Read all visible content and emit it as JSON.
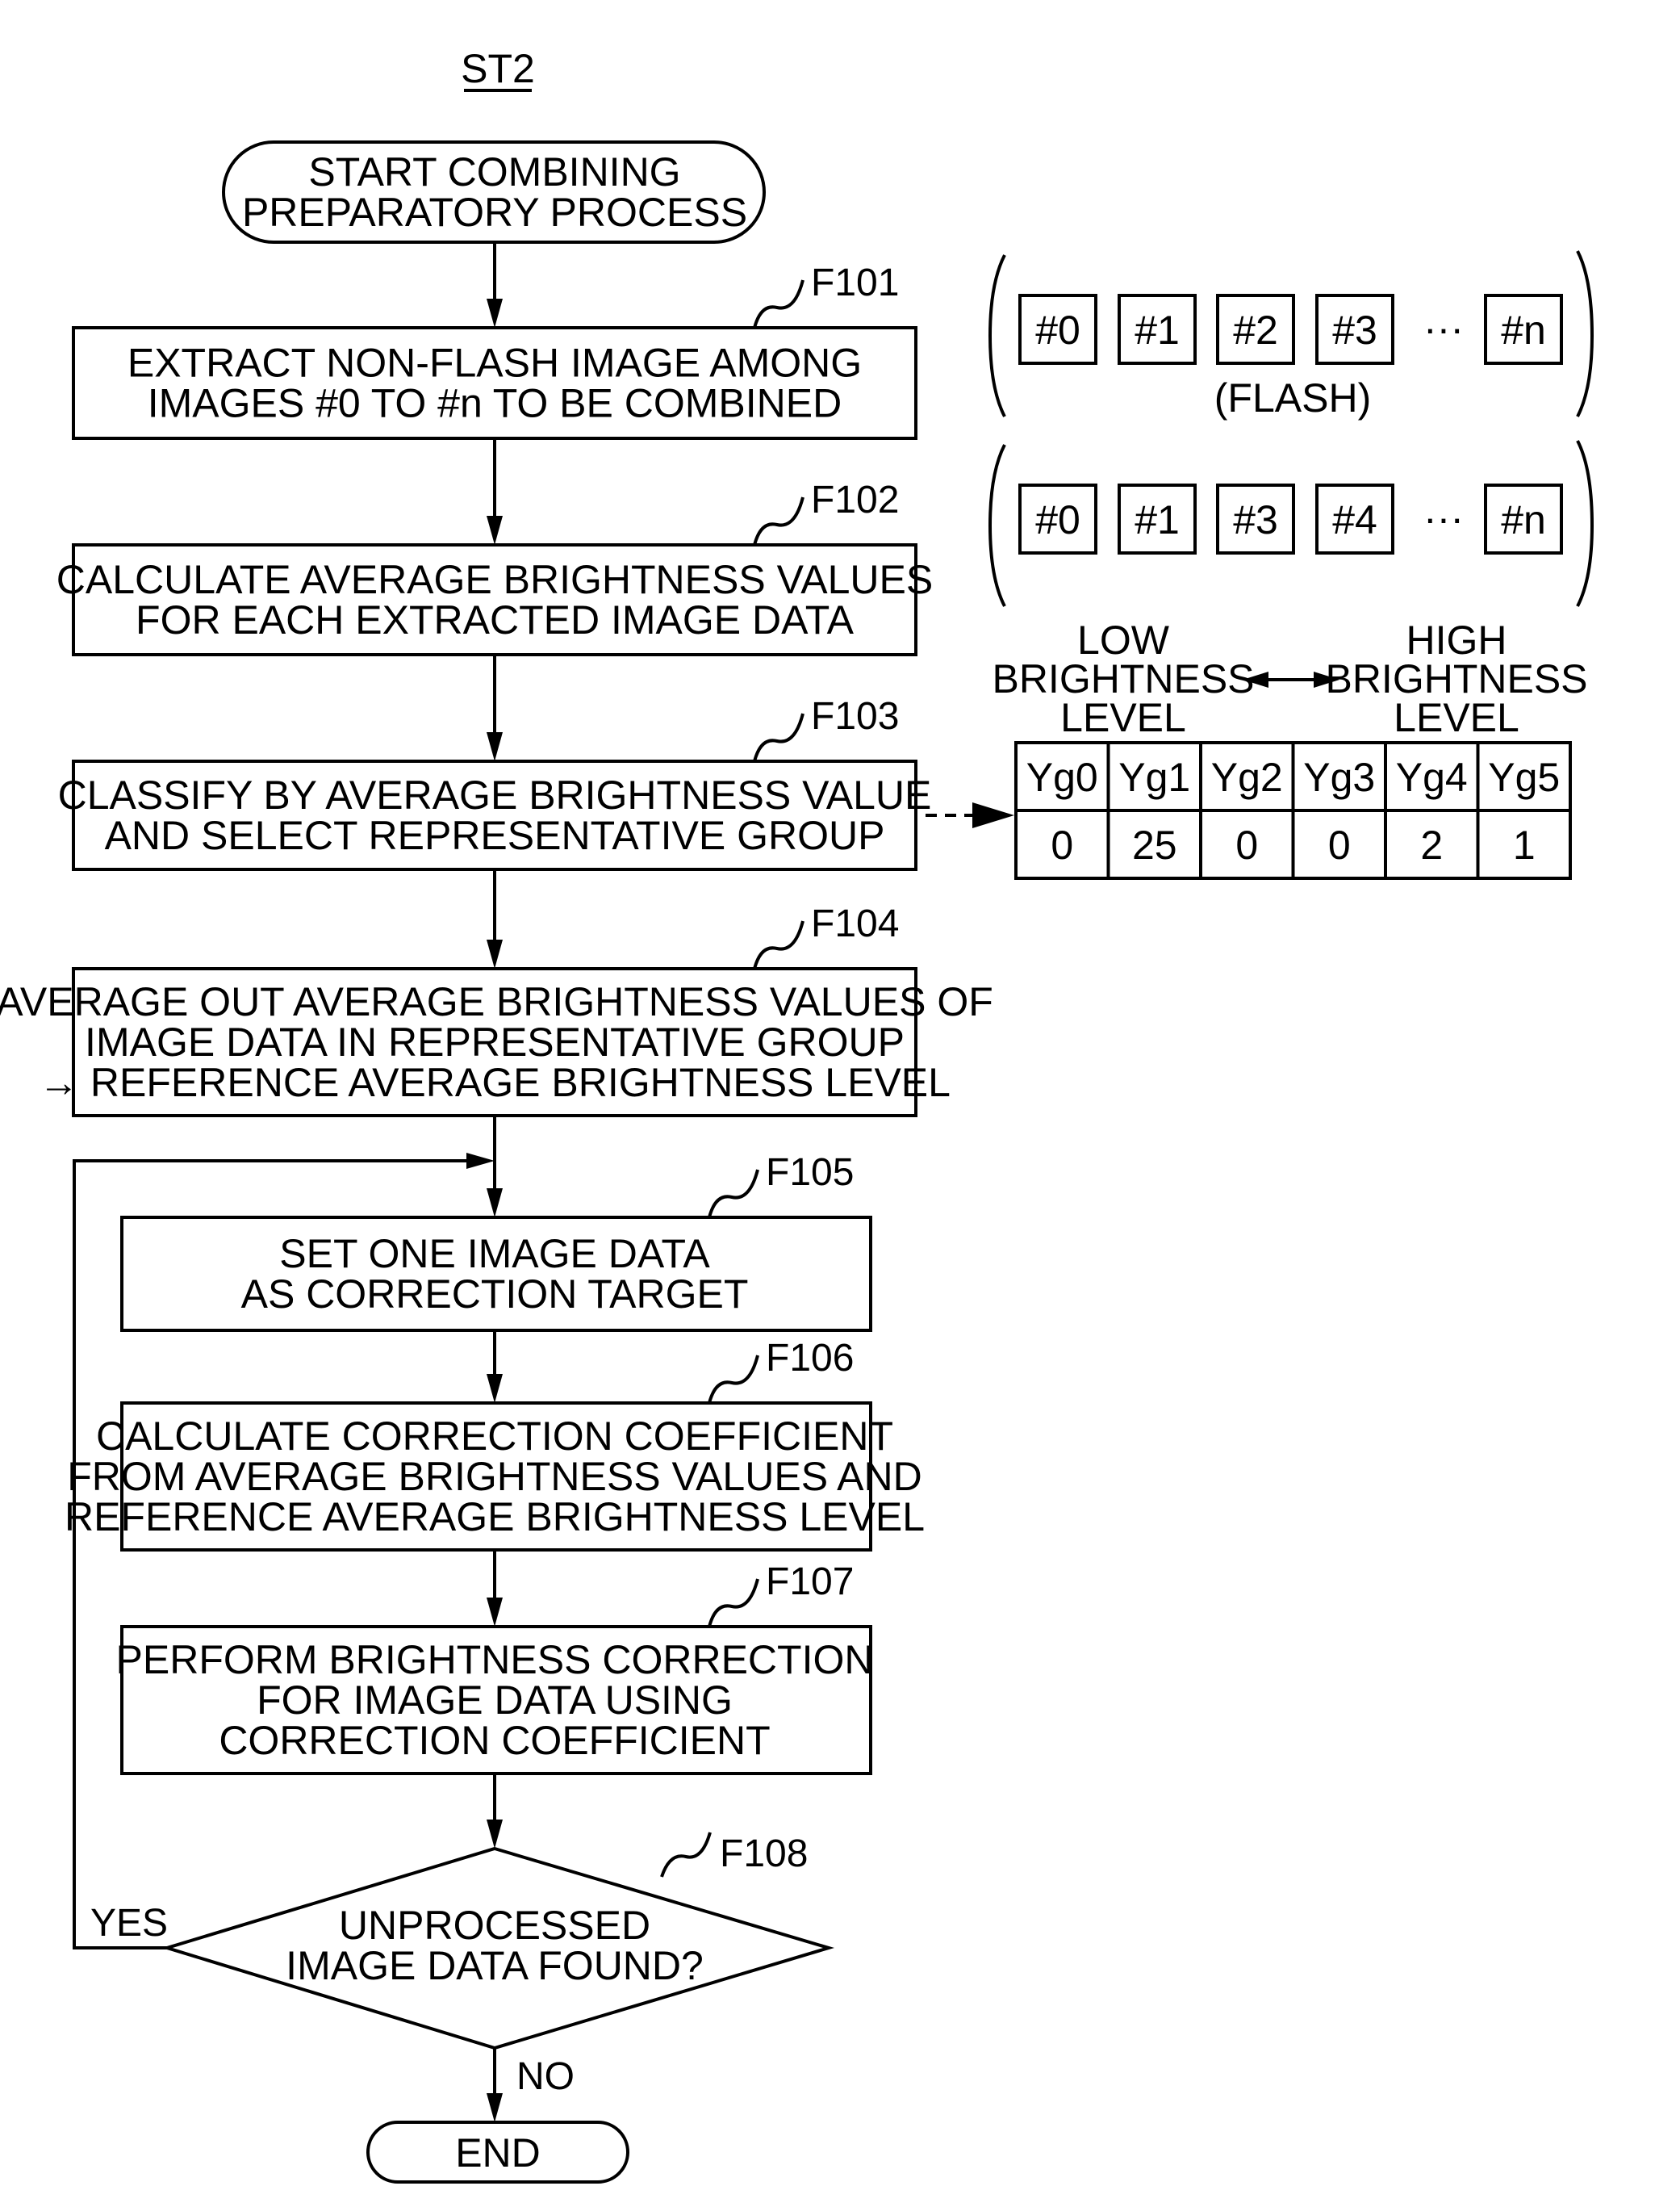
{
  "figure_label": "ST2",
  "start": {
    "line1": "START COMBINING",
    "line2": "PREPARATORY PROCESS"
  },
  "steps": [
    {
      "id": "F101",
      "lines": [
        "EXTRACT NON-FLASH IMAGE AMONG",
        "IMAGES #0 TO #n TO BE COMBINED"
      ]
    },
    {
      "id": "F102",
      "lines": [
        "CALCULATE AVERAGE BRIGHTNESS VALUES",
        "FOR EACH EXTRACTED IMAGE DATA"
      ]
    },
    {
      "id": "F103",
      "lines": [
        "CLASSIFY BY AVERAGE BRIGHTNESS VALUE",
        "AND SELECT REPRESENTATIVE GROUP"
      ]
    },
    {
      "id": "F104",
      "lines": [
        "AVERAGE OUT AVERAGE BRIGHTNESS VALUES OF",
        "IMAGE DATA IN REPRESENTATIVE GROUP",
        "→ REFERENCE AVERAGE BRIGHTNESS LEVEL"
      ]
    },
    {
      "id": "F105",
      "lines": [
        "SET ONE IMAGE DATA",
        "AS CORRECTION TARGET"
      ]
    },
    {
      "id": "F106",
      "lines": [
        "CALCULATE CORRECTION COEFFICIENT",
        "FROM AVERAGE BRIGHTNESS VALUES AND",
        "REFERENCE AVERAGE BRIGHTNESS LEVEL"
      ]
    },
    {
      "id": "F107",
      "lines": [
        "PERFORM BRIGHTNESS CORRECTION",
        "FOR IMAGE DATA USING",
        "CORRECTION COEFFICIENT"
      ]
    }
  ],
  "decision": {
    "id": "F108",
    "line1": "UNPROCESSED",
    "line2": "IMAGE DATA FOUND?",
    "yes": "YES",
    "no": "NO"
  },
  "end": "END",
  "image_sets": {
    "all": [
      "#0",
      "#1",
      "#2",
      "#3",
      "#n"
    ],
    "all_note": "(FLASH)",
    "extracted": [
      "#0",
      "#1",
      "#3",
      "#4",
      "#n"
    ],
    "ellipsis": "···"
  },
  "brightness_table": {
    "low_label": [
      "LOW",
      "BRIGHTNESS",
      "LEVEL"
    ],
    "high_label": [
      "HIGH",
      "BRIGHTNESS",
      "LEVEL"
    ],
    "groups": [
      "Yg0",
      "Yg1",
      "Yg2",
      "Yg3",
      "Yg4",
      "Yg5"
    ],
    "counts": [
      "0",
      "25",
      "0",
      "0",
      "2",
      "1"
    ]
  }
}
